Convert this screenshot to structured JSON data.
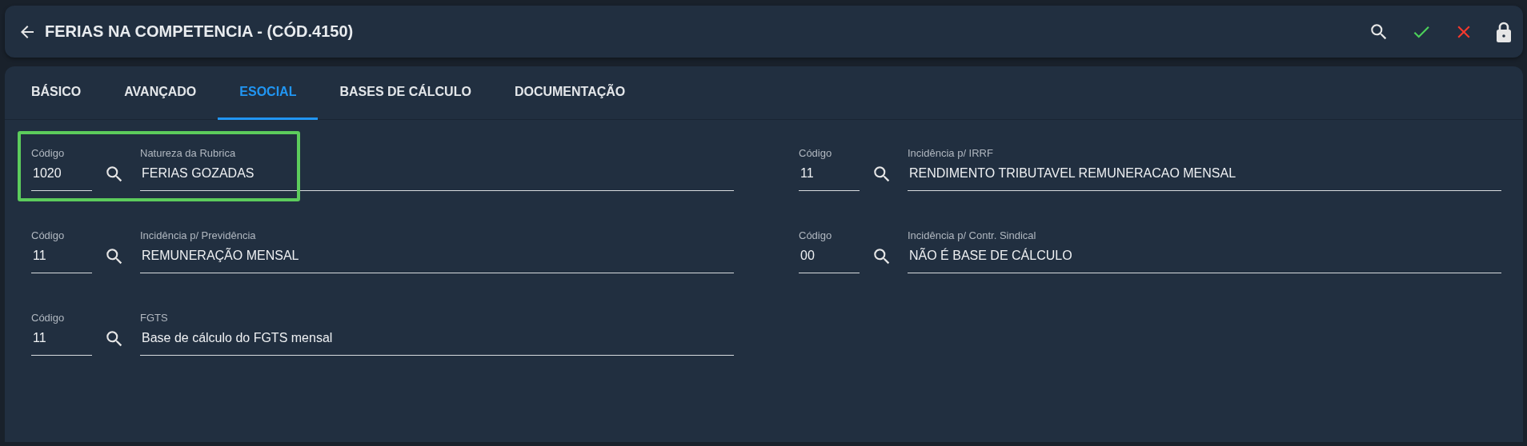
{
  "header": {
    "title": "FERIAS NA COMPETENCIA - (CÓD.4150)"
  },
  "tabs": [
    {
      "label": "BÁSICO",
      "selected": false
    },
    {
      "label": "AVANÇADO",
      "selected": false
    },
    {
      "label": "ESOCIAL",
      "selected": true
    },
    {
      "label": "BASES DE CÁLCULO",
      "selected": false
    },
    {
      "label": "DOCUMENTAÇÃO",
      "selected": false
    }
  ],
  "fields": [
    {
      "code_label": "Código",
      "code": "1020",
      "label": "Natureza da Rubrica",
      "value": "FERIAS GOZADAS",
      "highlighted": true
    },
    {
      "code_label": "Código",
      "code": "11",
      "label": "Incidência p/ IRRF",
      "value": "RENDIMENTO TRIBUTAVEL REMUNERACAO MENSAL",
      "highlighted": false
    },
    {
      "code_label": "Código",
      "code": "11",
      "label": "Incidência p/ Previdência",
      "value": "REMUNERAÇÃO MENSAL",
      "highlighted": false
    },
    {
      "code_label": "Código",
      "code": "00",
      "label": "Incidência p/ Contr. Sindical",
      "value": "NÃO É BASE DE CÁLCULO",
      "highlighted": false
    },
    {
      "code_label": "Código",
      "code": "11",
      "label": "FGTS",
      "value": "Base de cálculo do FGTS mensal",
      "highlighted": false
    }
  ]
}
